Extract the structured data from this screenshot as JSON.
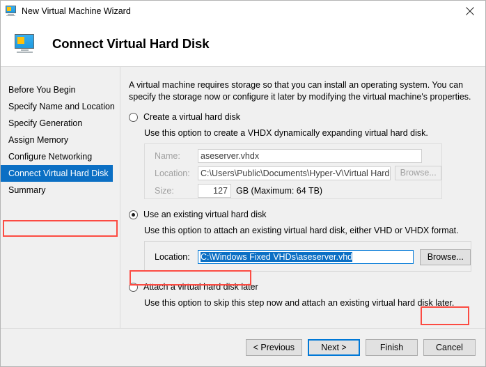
{
  "window": {
    "title": "New Virtual Machine Wizard",
    "icon": "virtual-machine-monitor-icon",
    "close_label": "✕"
  },
  "header": {
    "title": "Connect Virtual Hard Disk",
    "icon": "virtual-machine-monitor-icon"
  },
  "sidebar": {
    "items": [
      {
        "label": "Before You Begin",
        "selected": false
      },
      {
        "label": "Specify Name and Location",
        "selected": false
      },
      {
        "label": "Specify Generation",
        "selected": false
      },
      {
        "label": "Assign Memory",
        "selected": false
      },
      {
        "label": "Configure Networking",
        "selected": false
      },
      {
        "label": "Connect Virtual Hard Disk",
        "selected": true
      },
      {
        "label": "Summary",
        "selected": false
      }
    ]
  },
  "main": {
    "intro": "A virtual machine requires storage so that you can install an operating system. You can specify the storage now or configure it later by modifying the virtual machine's properties.",
    "options": [
      {
        "label": "Create a virtual hard disk",
        "description": "Use this option to create a VHDX dynamically expanding virtual hard disk.",
        "selected": false,
        "enabled": false
      },
      {
        "label": "Use an existing virtual hard disk",
        "description": "Use this option to attach an existing virtual hard disk, either VHD or VHDX format.",
        "selected": true,
        "enabled": true
      },
      {
        "label": "Attach a virtual hard disk later",
        "description": "Use this option to skip this step now and attach an existing virtual hard disk later.",
        "selected": false,
        "enabled": true
      }
    ],
    "create_group": {
      "name_label": "Name:",
      "name_value": "aseserver.vhdx",
      "location_label": "Location:",
      "location_value": "C:\\Users\\Public\\Documents\\Hyper-V\\Virtual Hard Disks\\",
      "browse_label": "Browse...",
      "size_label": "Size:",
      "size_value": "127",
      "size_unit": "GB (Maximum: 64 TB)"
    },
    "existing_group": {
      "location_label": "Location:",
      "location_value": "C:\\Windows Fixed VHDs\\aseserver.vhd",
      "browse_label": "Browse..."
    }
  },
  "footer": {
    "previous_label": "< Previous",
    "next_label": "Next >",
    "finish_label": "Finish",
    "cancel_label": "Cancel"
  },
  "annotations": {
    "color": "#fc4b42",
    "boxes": [
      "connect-virtual-hard-disk-nav",
      "use-existing-radio",
      "browse-button"
    ]
  },
  "colors": {
    "selection_blue": "#0b6fc4",
    "focus_blue": "#0078d7",
    "window_bg": "#f0f0f0",
    "annotation_red": "#fc4b42"
  }
}
